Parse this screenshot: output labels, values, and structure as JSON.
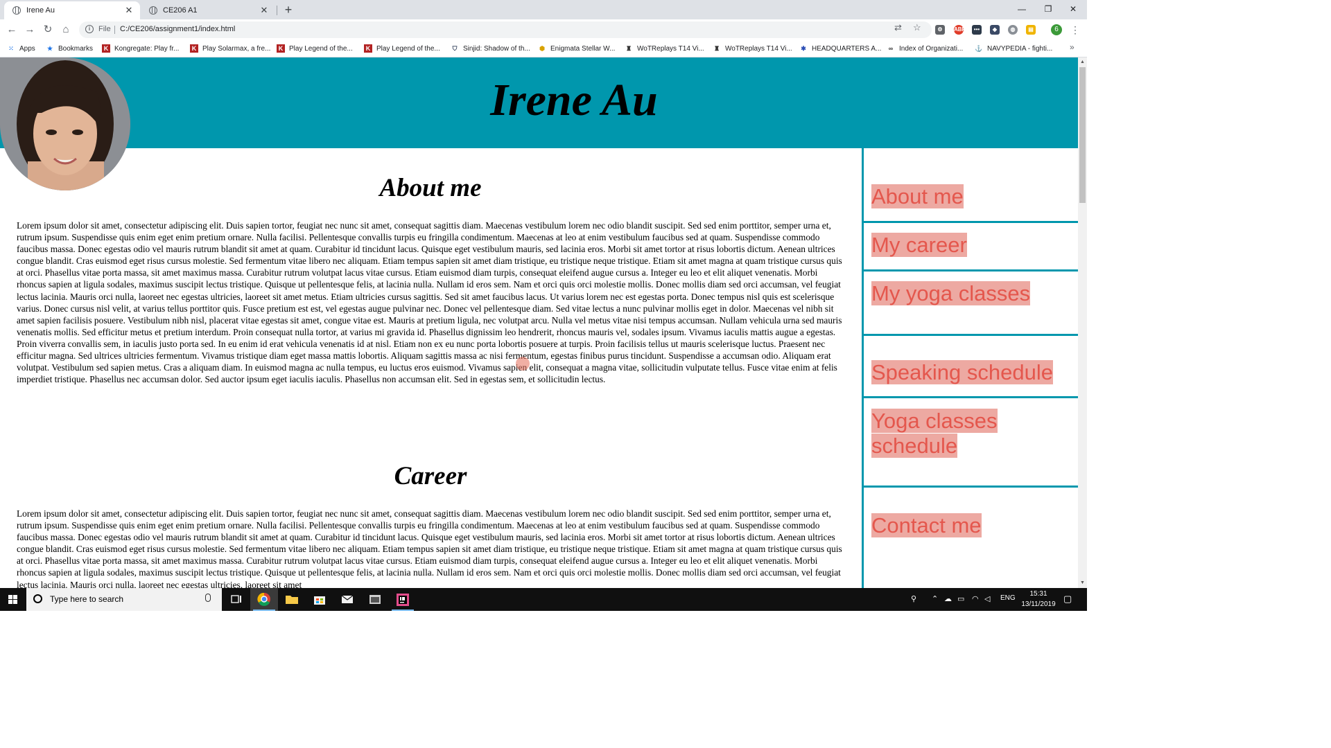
{
  "browser": {
    "tabs": [
      {
        "title": "Irene Au",
        "active": true
      },
      {
        "title": "CE206 A1",
        "active": false
      }
    ],
    "url_scheme": "File",
    "url": "C:/CE206/assignment1/index.html",
    "profile_initial": "6",
    "bookmarks": [
      {
        "label": "Apps",
        "icon": "apps-grid-icon"
      },
      {
        "label": "Bookmarks",
        "icon": "star-icon"
      },
      {
        "label": "Kongregate: Play fr...",
        "icon": "kongregate-icon"
      },
      {
        "label": "Play Solarmax, a fre...",
        "icon": "kongregate-icon"
      },
      {
        "label": "Play Legend of the...",
        "icon": "kongregate-icon"
      },
      {
        "label": "Play Legend of the...",
        "icon": "kongregate-icon"
      },
      {
        "label": "Sinjid: Shadow of th...",
        "icon": "shield-icon"
      },
      {
        "label": "Enigmata Stellar W...",
        "icon": "badge-icon"
      },
      {
        "label": "WoTReplays T14 Vi...",
        "icon": "wotreplays-icon"
      },
      {
        "label": "WoTReplays T14 Vi...",
        "icon": "wotreplays-icon"
      },
      {
        "label": "HEADQUARTERS A...",
        "icon": "hq-icon"
      },
      {
        "label": "Index of Organizati...",
        "icon": "organization-icon"
      },
      {
        "label": "NAVYPEDIA - fighti...",
        "icon": "navypedia-icon"
      }
    ]
  },
  "site": {
    "title": "Irene Au",
    "sections": [
      {
        "heading": "About me",
        "body": "Lorem ipsum dolor sit amet, consectetur adipiscing elit. Duis sapien tortor, feugiat nec nunc sit amet, consequat sagittis diam. Maecenas vestibulum lorem nec odio blandit suscipit. Sed sed enim porttitor, semper urna et, rutrum ipsum. Suspendisse quis enim eget enim pretium ornare. Nulla facilisi. Pellentesque convallis turpis eu fringilla condimentum. Maecenas at leo at enim vestibulum faucibus sed at quam. Suspendisse commodo faucibus massa. Donec egestas odio vel mauris rutrum blandit sit amet at quam. Curabitur id tincidunt lacus. Quisque eget vestibulum mauris, sed lacinia eros. Morbi sit amet tortor at risus lobortis dictum. Aenean ultrices congue blandit. Cras euismod eget risus cursus molestie. Sed fermentum vitae libero nec aliquam. Etiam tempus sapien sit amet diam tristique, eu tristique neque tristique. Etiam sit amet magna at quam tristique cursus quis at orci. Phasellus vitae porta massa, sit amet maximus massa. Curabitur rutrum volutpat lacus vitae cursus. Etiam euismod diam turpis, consequat eleifend augue cursus a. Integer eu leo et elit aliquet venenatis. Morbi rhoncus sapien at ligula sodales, maximus suscipit lectus tristique. Quisque ut pellentesque felis, at lacinia nulla. Nullam id eros sem. Nam et orci quis orci molestie mollis. Donec mollis diam sed orci accumsan, vel feugiat lectus lacinia. Mauris orci nulla, laoreet nec egestas ultricies, laoreet sit amet metus. Etiam ultricies cursus sagittis. Sed sit amet faucibus lacus. Ut varius lorem nec est egestas porta. Donec tempus nisl quis est scelerisque varius. Donec cursus nisl velit, at varius tellus porttitor quis. Fusce pretium est est, vel egestas augue pulvinar nec. Donec vel pellentesque diam. Sed vitae lectus a nunc pulvinar mollis eget in dolor. Maecenas vel nibh sit amet sapien facilisis posuere. Vestibulum nibh nisl, placerat vitae egestas sit amet, congue vitae est. Mauris at pretium ligula, nec volutpat arcu. Nulla vel metus vitae nisi tempus accumsan. Nullam vehicula urna sed mauris venenatis mollis. Sed efficitur metus et pretium interdum. Proin consequat nulla tortor, at varius mi gravida id. Phasellus dignissim leo hendrerit, rhoncus mauris vel, sodales ipsum. Vivamus iaculis mattis augue a egestas. Proin viverra convallis sem, in iaculis justo porta sed. In eu enim id erat vehicula venenatis id at nisl. Etiam non ex eu nunc porta lobortis posuere at turpis. Proin facilisis tellus ut mauris scelerisque luctus. Praesent nec efficitur magna. Sed ultrices ultricies fermentum. Vivamus tristique diam eget massa mattis lobortis. Aliquam sagittis massa ac nisi fermentum, egestas finibus purus tincidunt. Suspendisse a accumsan odio. Aliquam erat volutpat. Vestibulum sed sapien metus. Cras a aliquam diam. In euismod magna ac nulla tempus, eu luctus eros euismod. Vivamus sapien elit, consequat a magna vitae, sollicitudin vulputate tellus. Fusce vitae enim at felis imperdiet tristique. Phasellus nec accumsan dolor. Sed auctor ipsum eget iaculis iaculis. Phasellus non accumsan elit. Sed in egestas sem, et sollicitudin lectus."
      },
      {
        "heading": "Career",
        "body": "Lorem ipsum dolor sit amet, consectetur adipiscing elit. Duis sapien tortor, feugiat nec nunc sit amet, consequat sagittis diam. Maecenas vestibulum lorem nec odio blandit suscipit. Sed sed enim porttitor, semper urna et, rutrum ipsum. Suspendisse quis enim eget enim pretium ornare. Nulla facilisi. Pellentesque convallis turpis eu fringilla condimentum. Maecenas at leo at enim vestibulum faucibus sed at quam. Suspendisse commodo faucibus massa. Donec egestas odio vel mauris rutrum blandit sit amet at quam. Curabitur id tincidunt lacus. Quisque eget vestibulum mauris, sed lacinia eros. Morbi sit amet tortor at risus lobortis dictum. Aenean ultrices congue blandit. Cras euismod eget risus cursus molestie. Sed fermentum vitae libero nec aliquam. Etiam tempus sapien sit amet diam tristique, eu tristique neque tristique. Etiam sit amet magna at quam tristique cursus quis at orci. Phasellus vitae porta massa, sit amet maximus massa. Curabitur rutrum volutpat lacus vitae cursus. Etiam euismod diam turpis, consequat eleifend augue cursus a. Integer eu leo et elit aliquet venenatis. Morbi rhoncus sapien at ligula sodales, maximus suscipit lectus tristique. Quisque ut pellentesque felis, at lacinia nulla. Nullam id eros sem. Nam et orci quis orci molestie mollis. Donec mollis diam sed orci accumsan, vel feugiat lectus lacinia. Mauris orci nulla, laoreet nec egestas ultricies, laoreet sit amet"
      }
    ],
    "nav": [
      "About me",
      "My career",
      "My yoga classes",
      "Speaking schedule",
      "Yoga classes schedule",
      "Contact me"
    ],
    "colors": {
      "header_band": "#0097ad",
      "nav_text": "#e4574d",
      "nav_highlight": "#eda9a2"
    }
  },
  "taskbar": {
    "search_placeholder": "Type here to search",
    "language": "ENG",
    "time": "15:31",
    "date": "13/11/2019"
  }
}
